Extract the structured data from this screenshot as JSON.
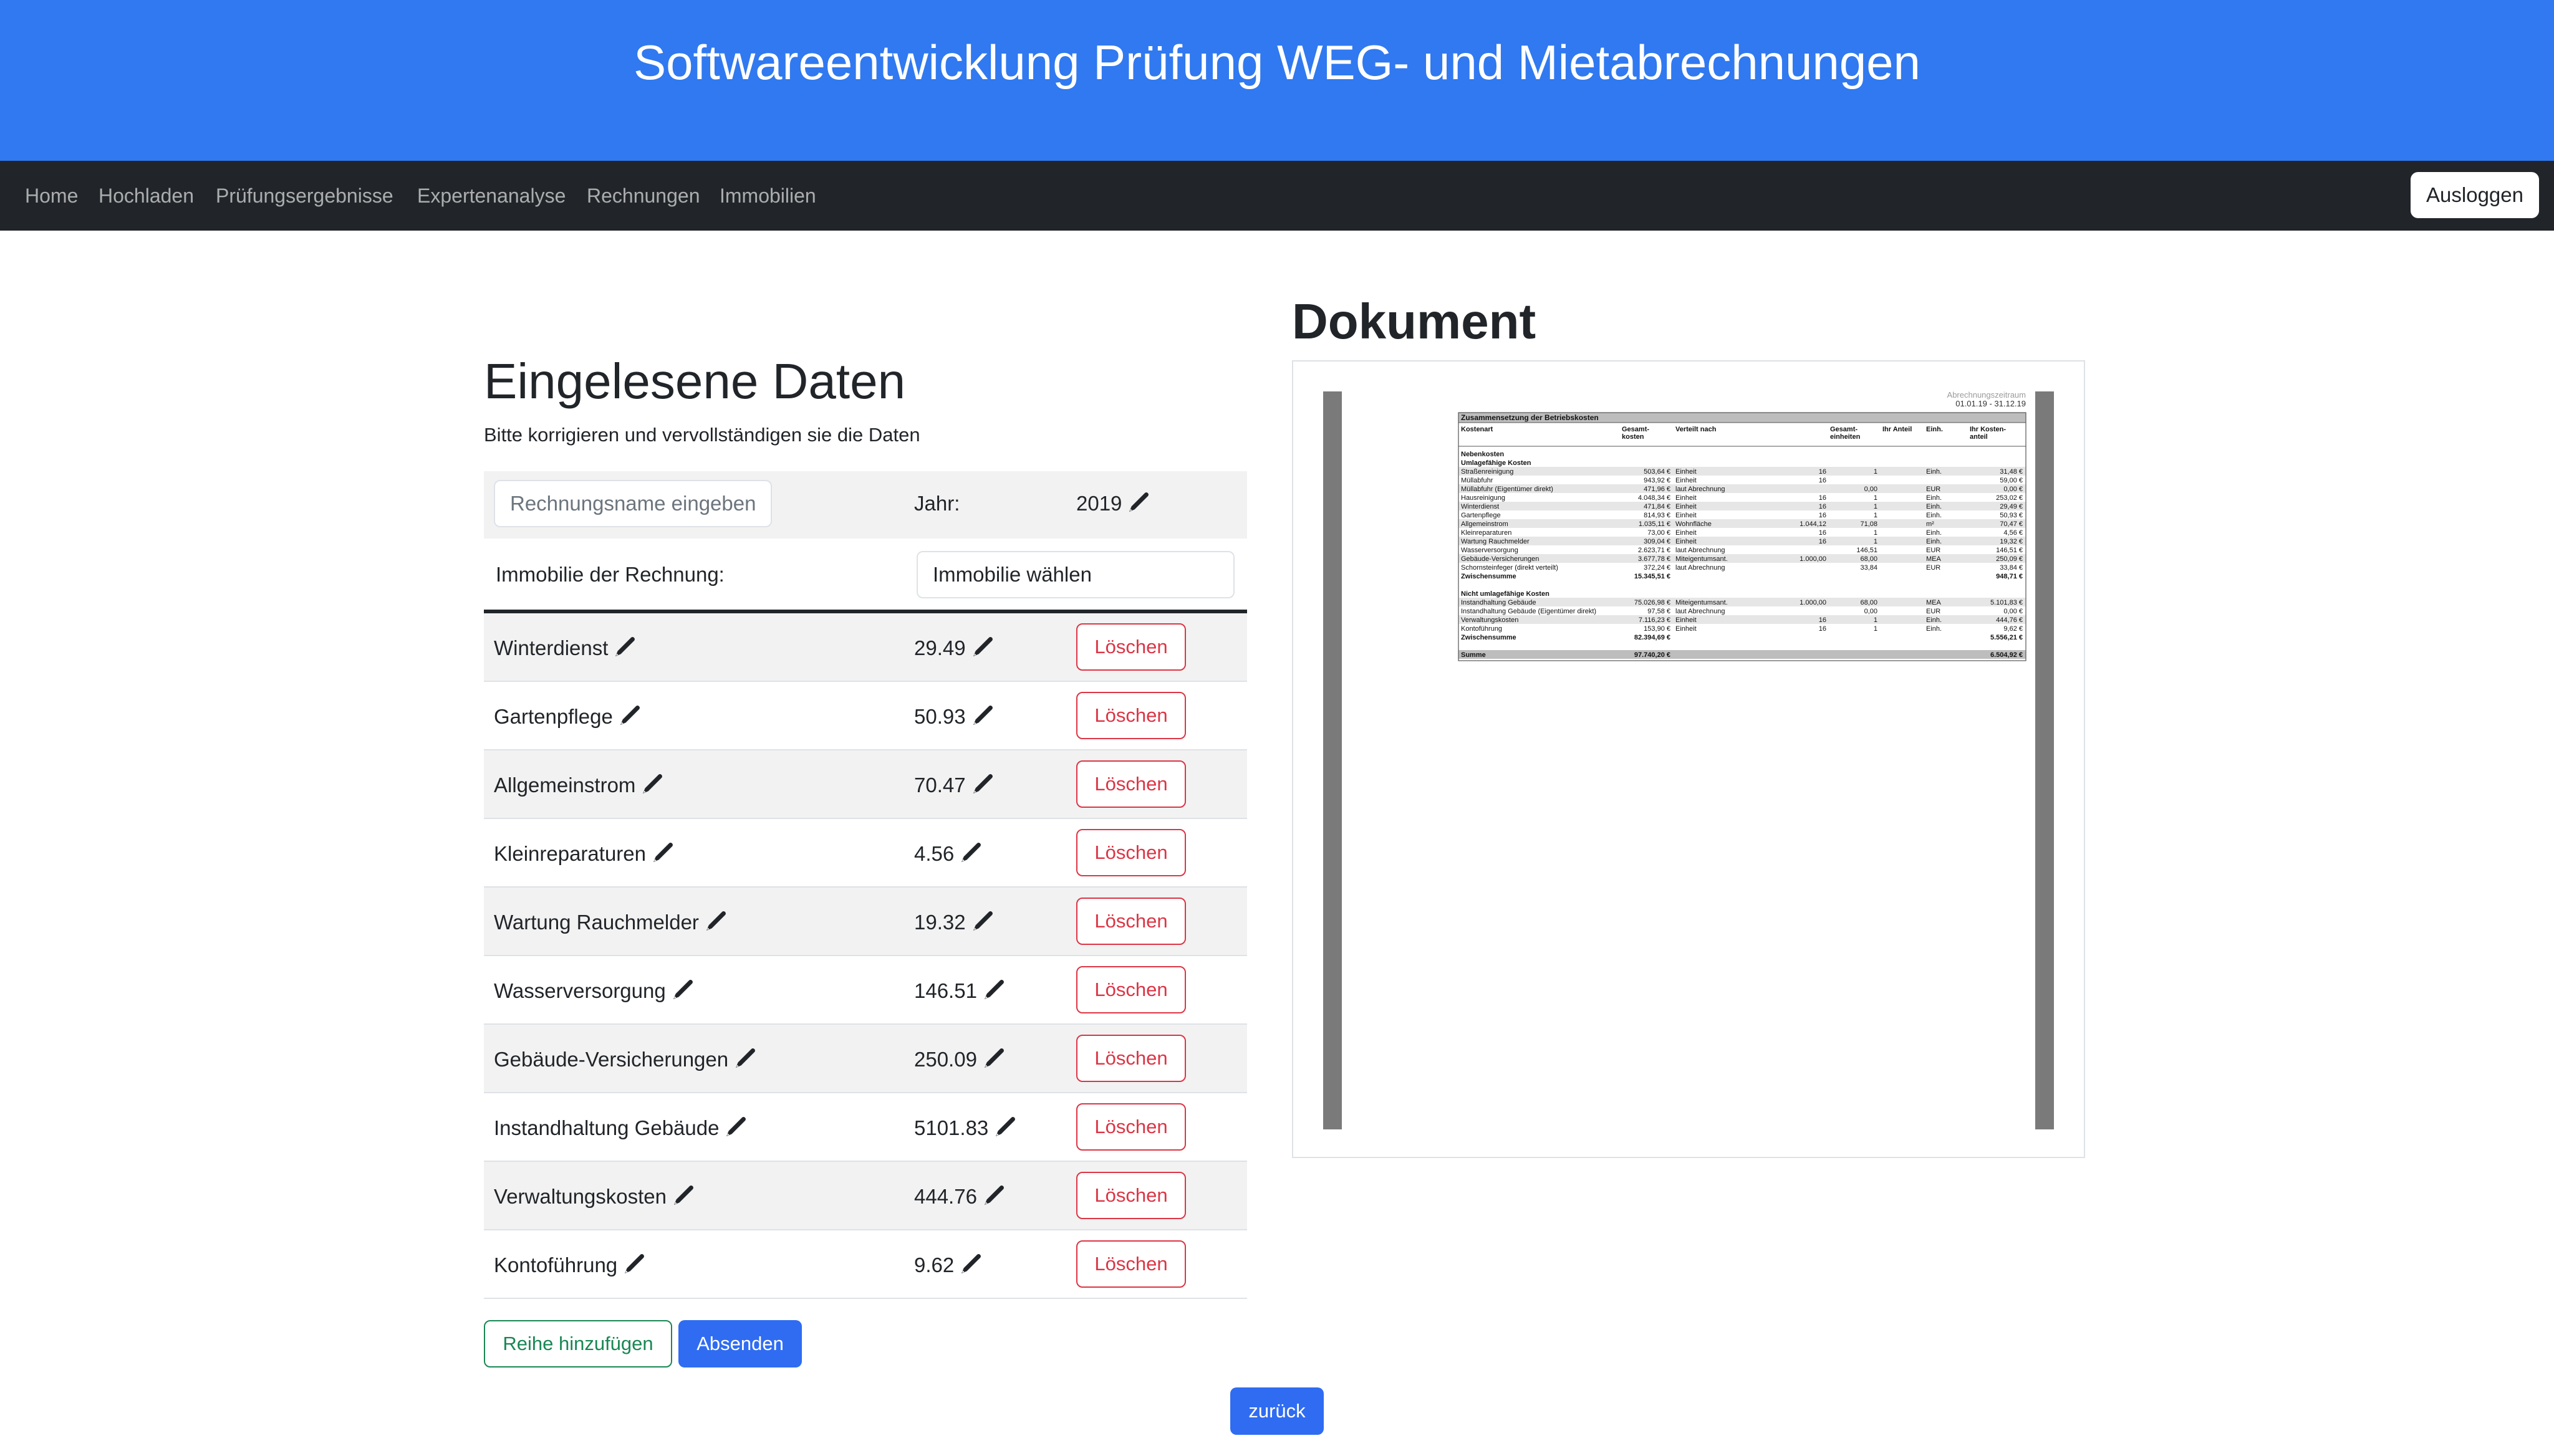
{
  "header": {
    "title": "Softwareentwicklung Prüfung WEG- und Mietabrechnungen"
  },
  "nav": {
    "links": [
      "Home",
      "Hochladen",
      "Prüfungsergebnisse",
      "Expertenanalyse",
      "Rechnungen",
      "Immobilien"
    ],
    "logout_label": "Ausloggen"
  },
  "form": {
    "heading": "Eingelesene Daten",
    "subtext": "Bitte korrigieren und vervollständigen sie die Daten",
    "name_placeholder": "Rechnungsname eingeben",
    "year_label": "Jahr:",
    "year_value": "2019",
    "property_label": "Immobilie der Rechnung:",
    "property_select": "Immobilie wählen",
    "delete_label": "Löschen",
    "rows": [
      {
        "name": "Winterdienst",
        "value": "29.49"
      },
      {
        "name": "Gartenpflege",
        "value": "50.93"
      },
      {
        "name": "Allgemeinstrom",
        "value": "70.47"
      },
      {
        "name": "Kleinreparaturen",
        "value": "4.56"
      },
      {
        "name": "Wartung Rauchmelder",
        "value": "19.32"
      },
      {
        "name": "Wasserversorgung",
        "value": "146.51"
      },
      {
        "name": "Gebäude-Versicherungen",
        "value": "250.09"
      },
      {
        "name": "Instandhaltung Gebäude",
        "value": "5101.83"
      },
      {
        "name": "Verwaltungskosten",
        "value": "444.76"
      },
      {
        "name": "Kontoführung",
        "value": "9.62"
      }
    ],
    "add_row_label": "Reihe hinzufügen",
    "submit_label": "Absenden",
    "back_label": "zurück"
  },
  "document": {
    "heading": "Dokument",
    "period_label": "Abrechnungszeitraum",
    "period": "01.01.19 - 31.12.19",
    "table_title": "Zusammensetzung der Betriebskosten",
    "columns": [
      "Kostenart",
      "Gesamt-\nkosten",
      "Verteilt nach",
      "Gesamt-\neinheiten",
      "Ihr Anteil",
      "Einh.",
      "Ihr Kosten-\nanteil"
    ],
    "sections": [
      {
        "title": "Nebenkosten",
        "bold": true
      },
      {
        "title": "Umlagefähige Kosten",
        "bold": true
      },
      {
        "row": [
          "Straßenreinigung",
          "503,64 €",
          "Einheit",
          "16",
          "1",
          "Einh.",
          "31,48 €"
        ]
      },
      {
        "row": [
          "Müllabfuhr",
          "943,92 €",
          "Einheit",
          "16",
          "",
          "",
          "59,00 €"
        ]
      },
      {
        "row": [
          "Müllabfuhr (Eigentümer direkt)",
          "471,96 €",
          "laut Abrechnung",
          "",
          "0,00",
          "EUR",
          "0,00 €"
        ]
      },
      {
        "row": [
          "Hausreinigung",
          "4.048,34 €",
          "Einheit",
          "16",
          "1",
          "Einh.",
          "253,02 €"
        ]
      },
      {
        "row": [
          "Winterdienst",
          "471,84 €",
          "Einheit",
          "16",
          "1",
          "Einh.",
          "29,49 €"
        ]
      },
      {
        "row": [
          "Gartenpflege",
          "814,93 €",
          "Einheit",
          "16",
          "1",
          "Einh.",
          "50,93 €"
        ]
      },
      {
        "row": [
          "Allgemeinstrom",
          "1.035,11 €",
          "Wohnfläche",
          "1.044,12",
          "71,08",
          "m²",
          "70,47 €"
        ]
      },
      {
        "row": [
          "Kleinreparaturen",
          "73,00 €",
          "Einheit",
          "16",
          "1",
          "Einh.",
          "4,56 €"
        ]
      },
      {
        "row": [
          "Wartung Rauchmelder",
          "309,04 €",
          "Einheit",
          "16",
          "1",
          "Einh.",
          "19,32 €"
        ]
      },
      {
        "row": [
          "Wasserversorgung",
          "2.623,71 €",
          "laut Abrechnung",
          "",
          "146,51",
          "EUR",
          "146,51 €"
        ]
      },
      {
        "row": [
          "Gebäude-Versicherungen",
          "3.677,78 €",
          "Miteigentumsant.",
          "1.000,00",
          "68,00",
          "MEA",
          "250,09 €"
        ]
      },
      {
        "row": [
          "Schornsteinfeger (direkt verteilt)",
          "372,24 €",
          "laut Abrechnung",
          "",
          "33,84",
          "EUR",
          "33,84 €"
        ]
      },
      {
        "sum": [
          "Zwischensumme",
          "15.345,51 €",
          "",
          "",
          "",
          "",
          "948,71 €"
        ]
      },
      {
        "title": "Nicht umlagefähige Kosten",
        "bold": true
      },
      {
        "row": [
          "Instandhaltung Gebäude",
          "75.026,98 €",
          "Miteigentumsant.",
          "1.000,00",
          "68,00",
          "MEA",
          "5.101,83 €"
        ]
      },
      {
        "row": [
          "Instandhaltung Gebäude (Eigentümer direkt)",
          "97,58 €",
          "laut Abrechnung",
          "",
          "0,00",
          "EUR",
          "0,00 €"
        ]
      },
      {
        "row": [
          "Verwaltungskosten",
          "7.116,23 €",
          "Einheit",
          "16",
          "1",
          "Einh.",
          "444,76 €"
        ]
      },
      {
        "row": [
          "Kontoführung",
          "153,90 €",
          "Einheit",
          "16",
          "1",
          "Einh.",
          "9,62 €"
        ]
      },
      {
        "sum": [
          "Zwischensumme",
          "82.394,69 €",
          "",
          "",
          "",
          "",
          "5.556,21 €"
        ]
      },
      {
        "sum": [
          "Summe",
          "97.740,20 €",
          "",
          "",
          "",
          "",
          "6.504,92 €"
        ]
      }
    ]
  },
  "colors": {
    "brand": "#3079f0",
    "navbar": "#212529",
    "danger": "#dc3545",
    "success": "#198754",
    "primary": "#2f6cf2"
  },
  "icons": {
    "edit": "pencil-icon"
  }
}
